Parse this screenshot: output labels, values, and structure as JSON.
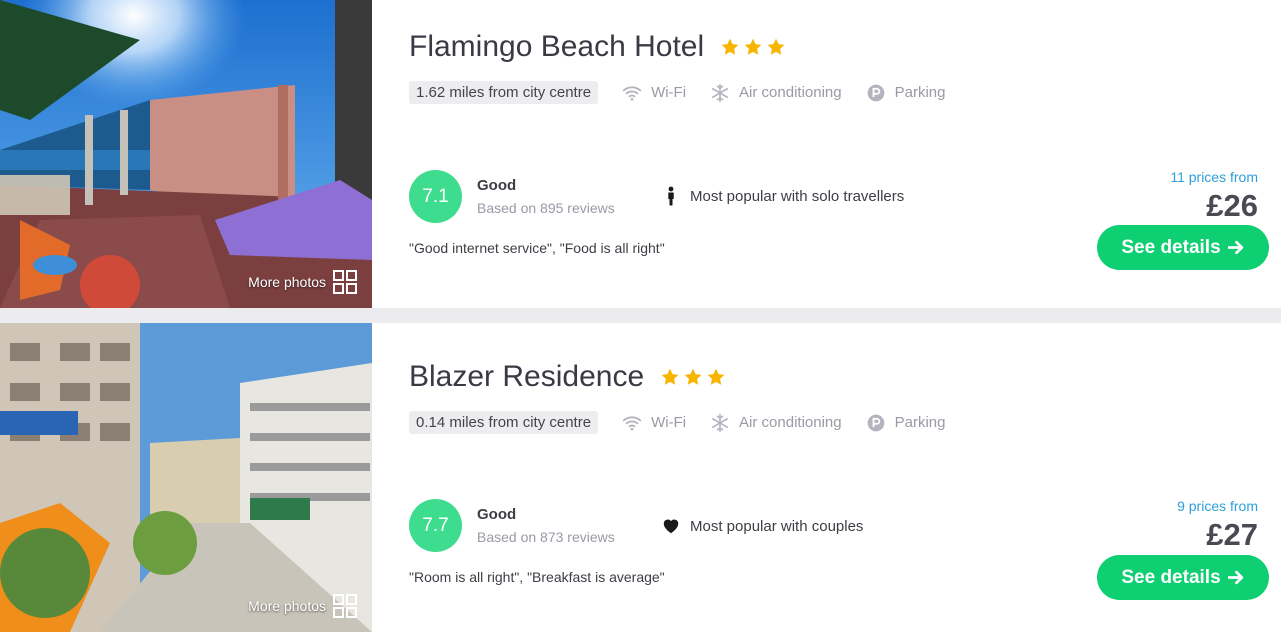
{
  "hotels": [
    {
      "name": "Flamingo Beach Hotel",
      "stars": 3,
      "distance": "1.62 miles from city centre",
      "amenities": [
        {
          "icon": "wifi-icon",
          "label": "Wi-Fi"
        },
        {
          "icon": "snowflake-icon",
          "label": "Air conditioning"
        },
        {
          "icon": "parking-icon",
          "label": "Parking"
        }
      ],
      "score": "7.1",
      "rating_word": "Good",
      "reviews": "Based on 895 reviews",
      "popular_icon": "solo-traveller-icon",
      "popular": "Most popular with solo travellers",
      "quote": "\"Good internet service\", \"Food is all right\"",
      "prices_from": "11 prices from",
      "price": "£26",
      "cta": "See details",
      "more_photos": "More photos"
    },
    {
      "name": "Blazer Residence",
      "stars": 3,
      "distance": "0.14 miles from city centre",
      "amenities": [
        {
          "icon": "wifi-icon",
          "label": "Wi-Fi"
        },
        {
          "icon": "snowflake-icon",
          "label": "Air conditioning"
        },
        {
          "icon": "parking-icon",
          "label": "Parking"
        }
      ],
      "score": "7.7",
      "rating_word": "Good",
      "reviews": "Based on 873 reviews",
      "popular_icon": "heart-icon",
      "popular": "Most popular with couples",
      "quote": "\"Room is all right\", \"Breakfast is average\"",
      "prices_from": "9 prices from",
      "price": "£27",
      "cta": "See details",
      "more_photos": "More photos"
    }
  ],
  "colors": {
    "score_green": "#3edc8e",
    "cta_green": "#0fcf73",
    "star_gold": "#f7b500",
    "link_blue": "#2d9fd8"
  }
}
